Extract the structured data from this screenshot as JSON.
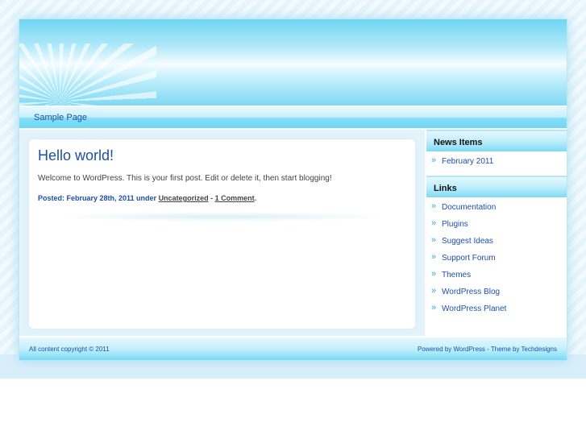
{
  "nav": {
    "items": [
      "Sample Page"
    ]
  },
  "post": {
    "title": "Hello world!",
    "body": "Welcome to WordPress. This is your first post. Edit or delete it, then start blogging!",
    "meta_prefix": "Posted: February 28th, 2011 under ",
    "category": "Uncategorized",
    "sep": " - ",
    "comments": "1 Comment",
    "end": "."
  },
  "sidebar": {
    "news_title": "News Items",
    "news": [
      "February 2011"
    ],
    "links_title": "Links",
    "links": [
      "Documentation",
      "Plugins",
      "Suggest Ideas",
      "Support Forum",
      "Themes",
      "WordPress Blog",
      "WordPress Planet"
    ]
  },
  "footer": {
    "left": "All content copyright © 2011",
    "right": "Powered by WordPress - Theme by Techdesigns"
  }
}
